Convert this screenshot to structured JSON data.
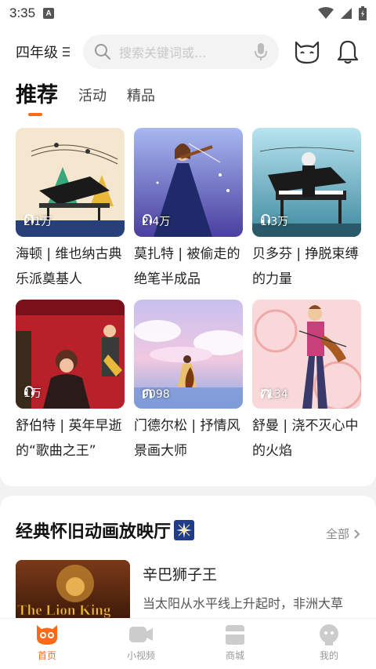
{
  "status_bar": {
    "time": "3:35",
    "notification_badge": "A"
  },
  "header": {
    "grade_label": "四年级",
    "search_placeholder": "搜索关键词或...",
    "icons": [
      "search-icon",
      "mic-icon",
      "cat-icon",
      "bell-icon"
    ]
  },
  "tabs": [
    {
      "label": "推荐",
      "active": true
    },
    {
      "label": "活动",
      "active": false
    },
    {
      "label": "精品",
      "active": false
    }
  ],
  "cards": [
    {
      "plays": "2.1万",
      "title": "海顿 | 维也纳古典乐派奠基人"
    },
    {
      "plays": "2.4万",
      "title": "莫扎特 | 被偷走的绝笔半成品"
    },
    {
      "plays": "1.3万",
      "title": "贝多芬 | 挣脱束缚的力量"
    },
    {
      "plays": "1万",
      "title": "舒伯特 | 英年早逝的“歌曲之王”"
    },
    {
      "plays": "9098",
      "title": "门德尔松 | 抒情风景画大师"
    },
    {
      "plays": "7134",
      "title": "舒曼 | 浇不灭心中的火焰"
    }
  ],
  "section": {
    "title": "经典怀旧动画放映厅",
    "all_label": "全部",
    "movie": {
      "poster_text": "The Lion King",
      "name": "辛巴狮子王",
      "desc": "当太阳从水平线上升起时，非洲大草"
    }
  },
  "bottom_nav": [
    {
      "label": "首页",
      "icon": "owl-icon",
      "active": true
    },
    {
      "label": "小视频",
      "icon": "video-icon",
      "active": false
    },
    {
      "label": "商城",
      "icon": "shop-icon",
      "active": false
    },
    {
      "label": "我的",
      "icon": "profile-icon",
      "active": false
    }
  ],
  "colors": {
    "accent": "#ff6a1a",
    "background": "#f2f2f2"
  }
}
